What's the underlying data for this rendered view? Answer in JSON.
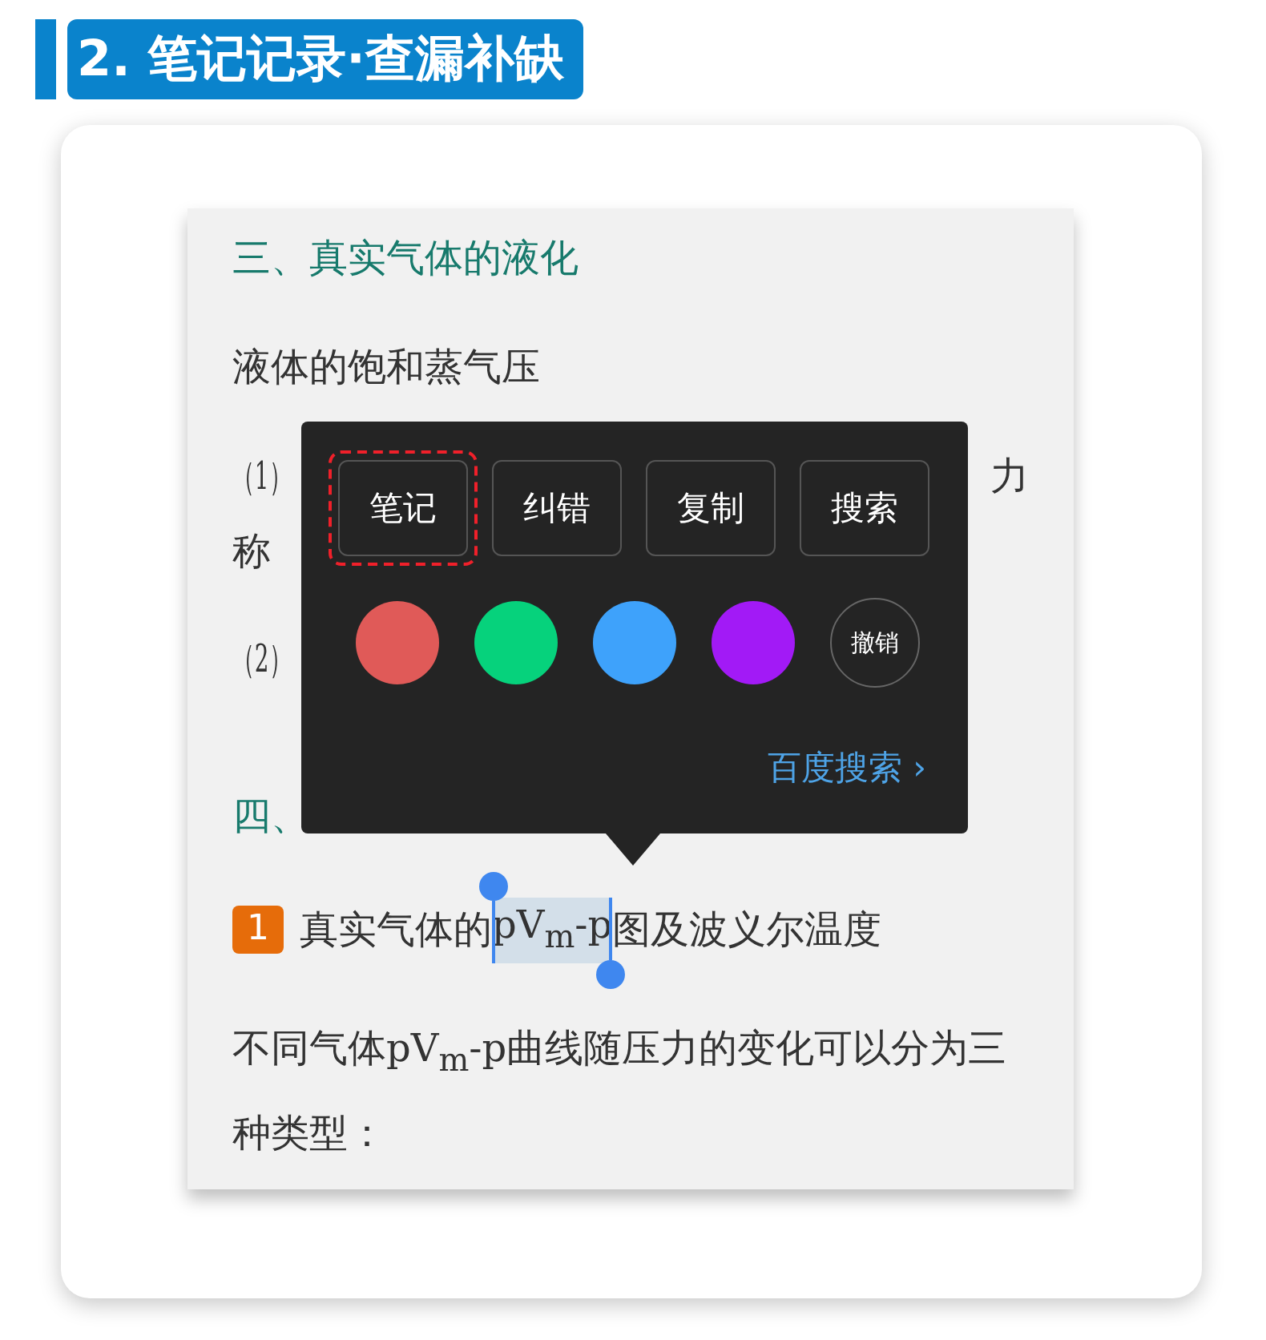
{
  "section_title": {
    "number": "2.",
    "text": "笔记记录·查漏补缺"
  },
  "document": {
    "heading_1": "三、真实气体的液化",
    "paragraph_1": "液体的饱和蒸气压",
    "line_1_start": "（1）",
    "line_1_end": "力",
    "line_2_start": "称",
    "line_3_start": "（2）",
    "heading_2_start": "四、",
    "item": {
      "number": "1",
      "before": "真实气体的",
      "selected": "pV$_{m}$-p",
      "after": "图及波义尔温度"
    },
    "paragraph_2": "不同气体pV$_{m}$-p曲线随压力的变化可以分为三种类型："
  },
  "popup": {
    "buttons": [
      {
        "label": "笔记",
        "highlighted": true
      },
      {
        "label": "纠错",
        "highlighted": false
      },
      {
        "label": "复制",
        "highlighted": false
      },
      {
        "label": "搜索",
        "highlighted": false
      }
    ],
    "colors": [
      {
        "color": "#e05a58"
      },
      {
        "color": "#06d27c"
      },
      {
        "color": "#3ea2fb"
      },
      {
        "color": "#a21af6"
      }
    ],
    "undo": "撤销",
    "search_link": "百度搜索",
    "search_chevron": "›"
  }
}
